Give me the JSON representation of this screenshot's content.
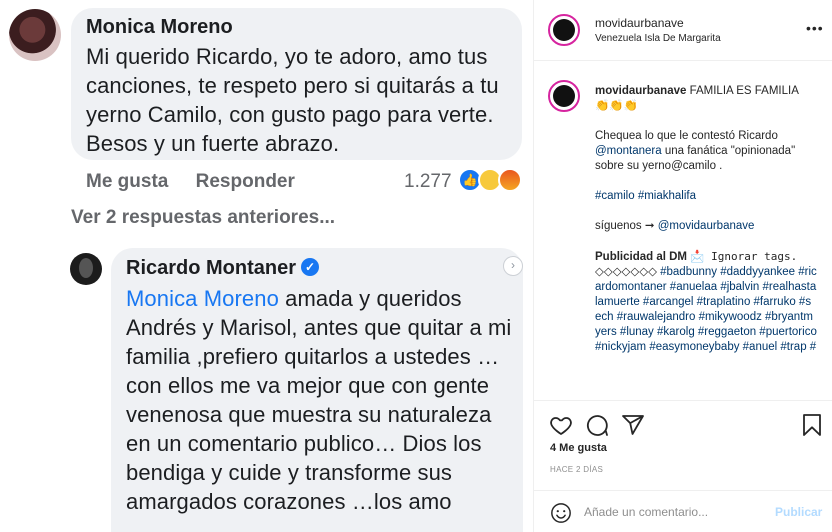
{
  "comment": {
    "author": "Monica Moreno",
    "text": "Mi querido Ricardo, yo te adoro, amo tus canciones, te respeto pero si quitarás a tu yerno Camilo, con gusto pago para verte. Besos y un fuerte abrazo.",
    "like_label": "Me gusta",
    "reply_label": "Responder",
    "reaction_count": "1.277",
    "previous_replies": "Ver 2 respuestas anteriores..."
  },
  "reply": {
    "author": "Ricardo Montaner",
    "mention": "Monica Moreno",
    "text": " amada y queridos Andrés y Marisol, antes que quitar a mi familia ,prefiero quitarlos a ustedes … con ellos me va mejor que con gente venenosa que muestra su naturaleza en un comentario publico… Dios los bendiga y cuide y transforme sus amargados corazones …los amo"
  },
  "instagram": {
    "username": "movidaurbanave",
    "location": "Venezuela Isla De Margarita",
    "caption_user": "movidaurbanave",
    "caption_title": " FAMILIA ES FAMILIA",
    "caption_emoji": "👏👏👏",
    "caption_line1": "Chequea lo que le contestó Ricardo ",
    "caption_mention": "@montanera",
    "caption_line1b": " una fanática \"opinionada\" sobre su yerno@camilo .",
    "caption_tags1": "#camilo #miakhalifa",
    "caption_follow": "síguenos ➞ ",
    "caption_follow_handle": "@movidaurbanave",
    "caption_ad": "Publicidad al DM",
    "caption_ignore": " Ignorar tags.",
    "caption_diamonds": "◇◇◇◇◇◇◇ ",
    "caption_tags2": "#badbunny #daddyyankee #ricardomontaner #anuelaa #jbalvin #realhastalamuerte #arcangel #traplatino #farruko #sech #rauwalejandro #mikywoodz #bryantmyers #lunay #karolg #reggaeton #puertorico #nickyjam #easymoneybaby #anuel #trap #",
    "likes": "4 Me gusta",
    "time_ago": "HACE 2 DÍAS",
    "comment_placeholder": "Añade un comentario...",
    "publish_label": "Publicar",
    "more_dots": "•••"
  },
  "colors": {
    "facebook_blue": "#1877f2",
    "ig_link": "#00376b"
  }
}
